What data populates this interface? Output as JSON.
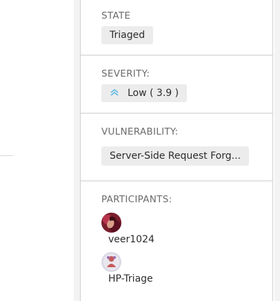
{
  "state": {
    "label": "STATE",
    "value": "Triaged"
  },
  "severity": {
    "label": "SEVERITY:",
    "value": "Low ( 3.9 )",
    "icon": "double-chevron-up-icon",
    "icon_color": "#5ab8e0"
  },
  "vulnerability": {
    "label": "VULNERABILITY:",
    "value": "Server-Side Request Forg..."
  },
  "participants": {
    "label": "PARTICIPANTS:",
    "items": [
      {
        "name": "veer1024",
        "avatar": "user-avatar"
      },
      {
        "name": "HP-Triage",
        "avatar": "triage-avatar"
      }
    ]
  }
}
